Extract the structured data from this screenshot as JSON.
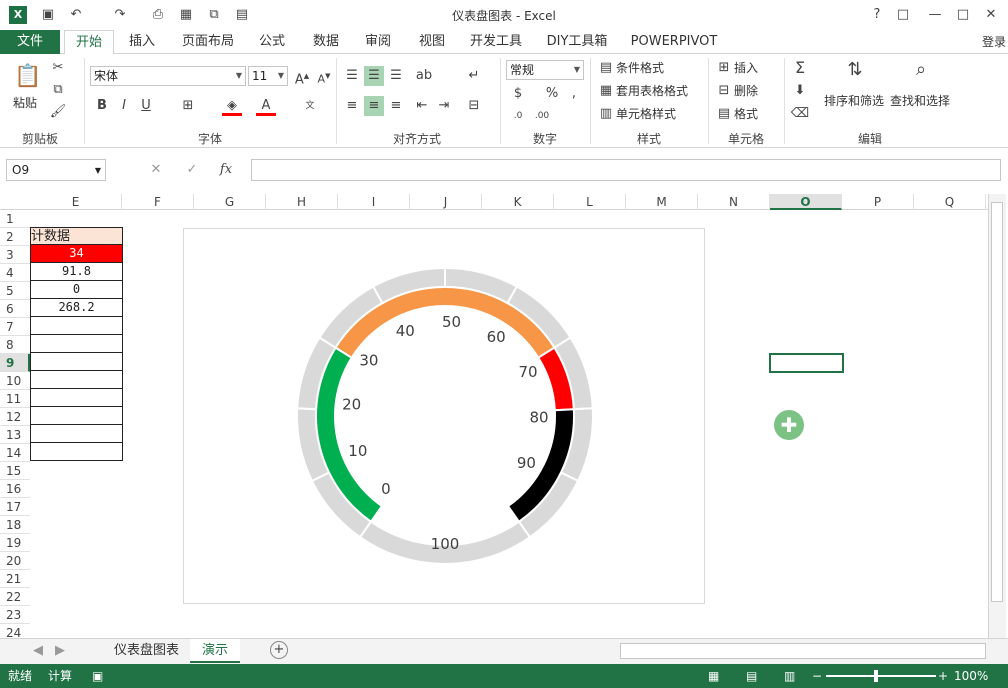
{
  "window": {
    "title": "仪表盘图表 - Excel",
    "logo": "X"
  },
  "qat": [
    "save-icon",
    "undo-icon",
    "redo-icon",
    "print-preview-icon"
  ],
  "window_controls": {
    "help": "?",
    "restore_ribbon": "□",
    "minimize": "—",
    "maximize": "□",
    "close": "✕"
  },
  "tabs": {
    "file": "文件",
    "items": [
      "开始",
      "插入",
      "页面布局",
      "公式",
      "数据",
      "审阅",
      "视图",
      "开发工具",
      "DIY工具箱",
      "POWERPIVOT"
    ],
    "login": "登录"
  },
  "ribbon": {
    "clipboard": {
      "label": "剪贴板",
      "paste": "粘贴"
    },
    "font": {
      "label": "字体",
      "name": "宋体",
      "size": "11"
    },
    "alignment": {
      "label": "对齐方式"
    },
    "number": {
      "label": "数字",
      "format": "常规"
    },
    "styles": {
      "label": "样式",
      "cond": "条件格式",
      "table": "套用表格格式",
      "cell": "单元格样式"
    },
    "cells": {
      "label": "单元格",
      "insert": "插入",
      "delete": "删除",
      "format": "格式"
    },
    "editing": {
      "label": "编辑",
      "sort": "排序和筛选",
      "find": "查找和选择"
    }
  },
  "formula_bar": {
    "name_box": "O9",
    "fx": "fx",
    "value": ""
  },
  "columns": [
    "E",
    "F",
    "G",
    "H",
    "I",
    "J",
    "K",
    "L",
    "M",
    "N",
    "O",
    "P",
    "Q"
  ],
  "selected_column": "O",
  "rows": [
    "1",
    "2",
    "3",
    "4",
    "5",
    "6",
    "7",
    "8",
    "9",
    "10",
    "11",
    "12",
    "13",
    "14",
    "15",
    "16",
    "17",
    "18",
    "19",
    "20",
    "21",
    "22",
    "23",
    "24"
  ],
  "selected_row": "9",
  "table": {
    "header": "计数据",
    "values": [
      "34",
      "91.8",
      "0",
      "268.2"
    ]
  },
  "chart_data": {
    "type": "gauge",
    "tick_labels": [
      "0",
      "10",
      "20",
      "30",
      "40",
      "50",
      "60",
      "70",
      "80",
      "90",
      "100"
    ],
    "bands": [
      {
        "from": 0,
        "to": 30,
        "color": "#00b050"
      },
      {
        "from": 30,
        "to": 70,
        "color": "#f79646"
      },
      {
        "from": 70,
        "to": 80,
        "color": "#ff0000"
      },
      {
        "from": 80,
        "to": 100,
        "color": "#000000"
      }
    ],
    "pointer_value": 34,
    "outer_ring_color": "#d9d9d9"
  },
  "sheets": [
    "仪表盘图表",
    "演示"
  ],
  "active_sheet": "演示",
  "status": {
    "ready": "就绪",
    "calc": "计算",
    "zoom": "100%"
  }
}
